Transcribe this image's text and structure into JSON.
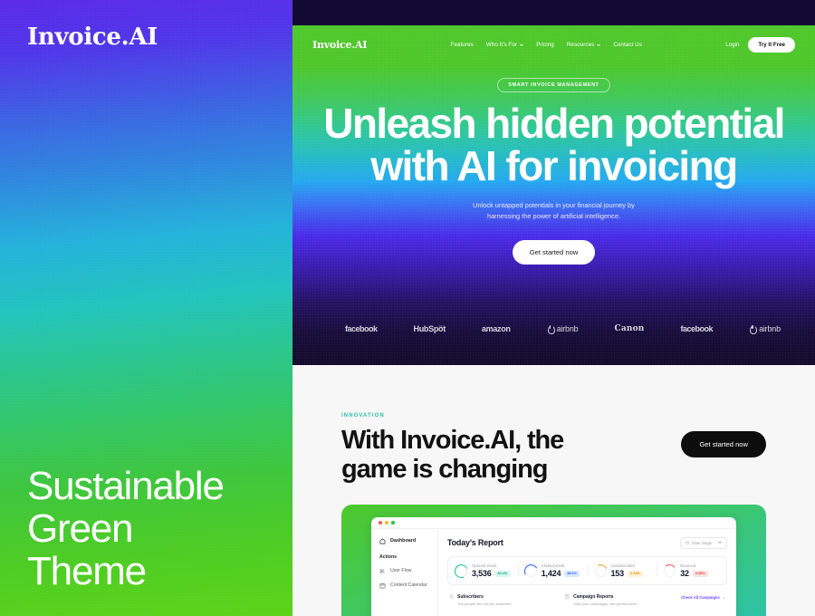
{
  "brand": {
    "logo": "Invoice.AI",
    "caption": "Sustainable\nGreen\nTheme",
    "caption_lines": [
      "Sustainable",
      "Green",
      "Theme"
    ],
    "gradient_from": "#5a2ae8",
    "gradient_to": "#5cd317"
  },
  "site": {
    "nav": {
      "logo": "Invoice.AI",
      "links": [
        {
          "label": "Features",
          "has_chevron": false
        },
        {
          "label": "Who It's For",
          "has_chevron": true
        },
        {
          "label": "Pricing",
          "has_chevron": false
        },
        {
          "label": "Resources",
          "has_chevron": true
        },
        {
          "label": "Contact Us",
          "has_chevron": false
        }
      ],
      "login_label": "Login",
      "cta_label": "Try It Free"
    },
    "hero": {
      "badge": "SMART INVOICE MANAGEMENT",
      "title": "Unleash hidden potential with AI for invoicing",
      "subtitle_line1": "Unlock untapped potentials in your financial journey by",
      "subtitle_line2": "harnessing the power of artificial intelligence.",
      "cta_label": "Get started now",
      "gradient_top": "#4ec72a",
      "gradient_mid": "#25a8f0",
      "gradient_bottom": "#110a2c"
    },
    "logo_strip": [
      {
        "name": "facebook",
        "style": "lg-facebook",
        "mark": false
      },
      {
        "name": "HubSpöt",
        "style": "lg-hubspot",
        "mark": false
      },
      {
        "name": "amazon",
        "style": "lg-amazon",
        "mark": false
      },
      {
        "name": "airbnb",
        "style": "lg-airbnb",
        "mark": true
      },
      {
        "name": "Canon",
        "style": "lg-canon",
        "mark": false
      },
      {
        "name": "facebook",
        "style": "lg-facebook",
        "mark": false
      },
      {
        "name": "airbnb",
        "style": "lg-airbnb",
        "mark": true
      }
    ],
    "innovation": {
      "eyebrow": "INNOVATION",
      "eyebrow_color": "#2bbfa0",
      "title_line1": "With Invoice.AI, the",
      "title_line2": "game is changing",
      "cta_label": "Get started now"
    },
    "dashboard": {
      "sidebar": {
        "primary_item": "Dashboard",
        "section_header": "Actions",
        "items": [
          "User Flow",
          "Content Calendar"
        ]
      },
      "header": {
        "title": "Today's Report",
        "date_range_label": "Date range"
      },
      "stats": [
        {
          "label": "Opened email",
          "value": "3,536",
          "delta": "83.4%",
          "tone": "g"
        },
        {
          "label": "Clicked email",
          "value": "1,424",
          "delta": "38.1%",
          "tone": "b"
        },
        {
          "label": "Unsubscribed",
          "value": "153",
          "delta": "1.74%",
          "tone": "y"
        },
        {
          "label": "Bounced",
          "value": "32",
          "delta": "0.38%",
          "tone": "r"
        }
      ],
      "lower": [
        {
          "title": "Subscribers",
          "sub": "The people who let you subscribe"
        },
        {
          "title": "Campaign Reports",
          "sub": "View your campaigns, see performance"
        }
      ],
      "link_label": "Check All Campaigns"
    }
  }
}
